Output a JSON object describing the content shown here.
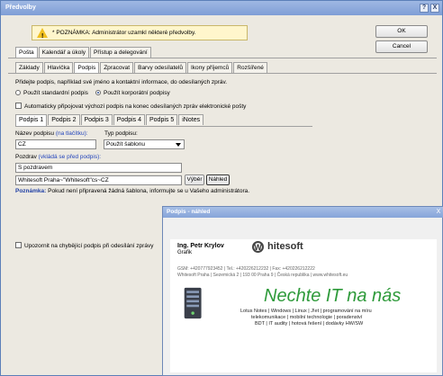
{
  "window": {
    "title": "Předvolby",
    "help_glyph": "?",
    "close_glyph": "X"
  },
  "notice": {
    "text": "* POZNÁMKA: Administrátor uzamkl některé předvolby."
  },
  "buttons": {
    "ok": "OK",
    "cancel": "Cancel"
  },
  "main_tabs": [
    "Pošta",
    "Kalendář a úkoly",
    "Přístup a delegování"
  ],
  "sub_tabs": [
    "Základy",
    "Hlavička",
    "Podpis",
    "Zpracovat",
    "Barvy odesílatelů",
    "Ikony příjemců",
    "Rozšířené"
  ],
  "signature": {
    "intro": "Přidejte podpis, například své jméno a kontaktní informace, do odesílaných zpráv.",
    "radio_standard": "Použít standardní podpis",
    "radio_corporate": "Použít korporátní podpisy",
    "auto_append": "Automaticky připojovat výchozí podpis na konec odesílaných zpráv elektronické pošty",
    "tabs": [
      "Podpis 1",
      "Podpis 2",
      "Podpis 3",
      "Podpis 4",
      "Podpis 5",
      "iNotes"
    ],
    "name_label": "Název podpisu",
    "name_hint": "(na tlačítku):",
    "type_label": "Typ podpisu:",
    "name_value": "CZ",
    "type_value": "Použít šablonu",
    "greeting_label": "Pozdrav",
    "greeting_hint": "(vkládá se před podpis):",
    "greeting_value": "S pozdravem",
    "template_value": "Whitesoft Praha~\"Whitesoft\"cs~CZ",
    "select_button": "Výběr",
    "preview_button": "Náhled",
    "note_label": "Poznámka:",
    "note_text": "Pokud není připravená žádná šablona, informujte se u Vašeho administrátora.",
    "warn_missing": "Upozornit na chybějící podpis při odesílání zprávy"
  },
  "preview": {
    "title": "Podpis - náhled",
    "close_glyph": "X",
    "person_name": "Ing. Petr Krylov",
    "person_role": "Grafik",
    "logo": "hitesoft",
    "contact_line1": "GSM: +420777923452  |  Tel.: +420226212232  |  Fax: +420226212222",
    "contact_line2": "Whitesoft Praha  |  Sezemická 2  |  193 00   Praha 9  |  Česká republika  |  www.whitesoft.eu",
    "slogan": "Nechte IT na nás",
    "banner_line1": "Lotus Notes | Windows | Linux | J!et | programování na míru",
    "banner_line2": "telekomunikace | mobilní technologie | poradenství",
    "banner_line3": "BDT | IT audity | hotová řešení | dodávky HW/SW"
  },
  "colors": {
    "title_bar": "#7f9ed6",
    "link_blue": "#2244bb",
    "slogan_green": "#2e9a3a",
    "notice_bg": "#fff6cc"
  }
}
